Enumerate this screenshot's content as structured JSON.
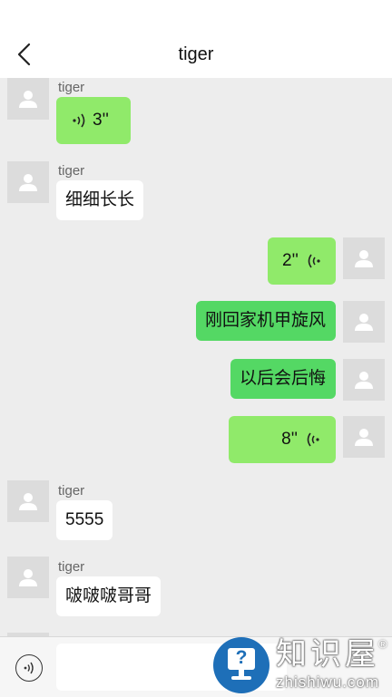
{
  "header": {
    "title": "tiger"
  },
  "messages": [
    {
      "side": "left",
      "sender": "tiger",
      "type": "voice",
      "duration": "3''"
    },
    {
      "side": "left",
      "sender": "tiger",
      "type": "text",
      "text": "细细长长"
    },
    {
      "side": "right",
      "type": "voice",
      "duration": "2''"
    },
    {
      "side": "right",
      "type": "text",
      "text": "刚回家机甲旋风"
    },
    {
      "side": "right",
      "type": "text",
      "text": "以后会后悔"
    },
    {
      "side": "right",
      "type": "voice",
      "duration": "8''"
    },
    {
      "side": "left",
      "sender": "tiger",
      "type": "text",
      "text": "5555"
    },
    {
      "side": "left",
      "sender": "tiger",
      "type": "text",
      "text": "啵啵啵哥哥"
    }
  ],
  "watermark": {
    "brand": "知识屋",
    "url": "zhishiwu.com",
    "registered": "®"
  },
  "icons": [
    "back-arrow-icon",
    "user-avatar-icon",
    "voice-wave-icon",
    "voice-input-icon",
    "help-icon"
  ],
  "colors": {
    "incoming_voice": "#90ea6a",
    "outgoing_text": "#54d864",
    "outgoing_voice": "#90ea6a",
    "incoming_text": "#ffffff",
    "background": "#ededed",
    "watermark_blue": "#1e6fb8"
  }
}
